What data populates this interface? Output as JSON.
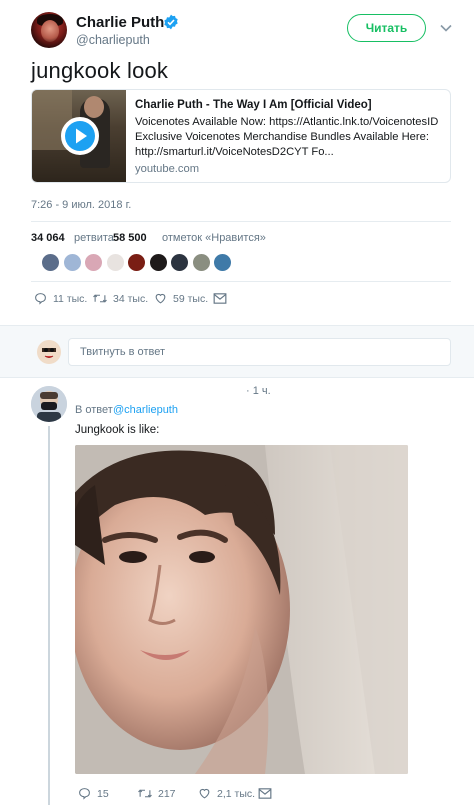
{
  "tweet": {
    "display_name": "Charlie Puth",
    "handle": "@charlieputh",
    "follow_label": "Читать",
    "text": "jungkook look",
    "card": {
      "title": "Charlie Puth - The Way I Am [Official Video]",
      "desc_line1": "Voicenotes Available Now: https://Atlantic.lnk.to/VoicenotesID",
      "desc_line2": "Exclusive Voicenotes Merchandise Bundles Available Here:",
      "desc_line3": "http://smarturl.it/VoiceNotesD2CYT Fo...",
      "domain": "youtube.com"
    },
    "timestamp": "7:26 - 9 июл. 2018 г.",
    "stats": {
      "retweets": "34 064",
      "retweets_label": "ретвита",
      "likes": "58 500",
      "likes_label": "отметок «Нравится»"
    },
    "actions": {
      "replies": "11 тыс.",
      "retweets": "34 тыс.",
      "likes": "59 тыс."
    }
  },
  "composer": {
    "placeholder": "Твитнуть в ответ"
  },
  "reply": {
    "time": "· 1 ч.",
    "reply_to_label": "В ответ",
    "reply_to_handle": "@charlieputh",
    "text": "Jungkook is like:",
    "actions": {
      "replies": "15",
      "retweets": "217",
      "likes": "2,1 тыс."
    }
  },
  "colors": {
    "follow_green": "#17bf63",
    "verified_blue": "#1da1f2",
    "link_blue": "#1da1f2",
    "secondary_text": "#657786"
  },
  "likers": [
    {
      "color": "#5b6d8a",
      "icon": "liker-avatar"
    },
    {
      "color": "#9fb6d6",
      "icon": "liker-avatar"
    },
    {
      "color": "#d9a7b5",
      "icon": "liker-avatar"
    },
    {
      "color": "#e8e3e0",
      "icon": "liker-avatar"
    },
    {
      "color": "#7a1e14",
      "icon": "liker-avatar"
    },
    {
      "color": "#1e1a1a",
      "icon": "liker-avatar"
    },
    {
      "color": "#2c3440",
      "icon": "liker-avatar"
    },
    {
      "color": "#8a8e80",
      "icon": "liker-avatar"
    },
    {
      "color": "#3f7aa8",
      "icon": "liker-avatar"
    }
  ]
}
